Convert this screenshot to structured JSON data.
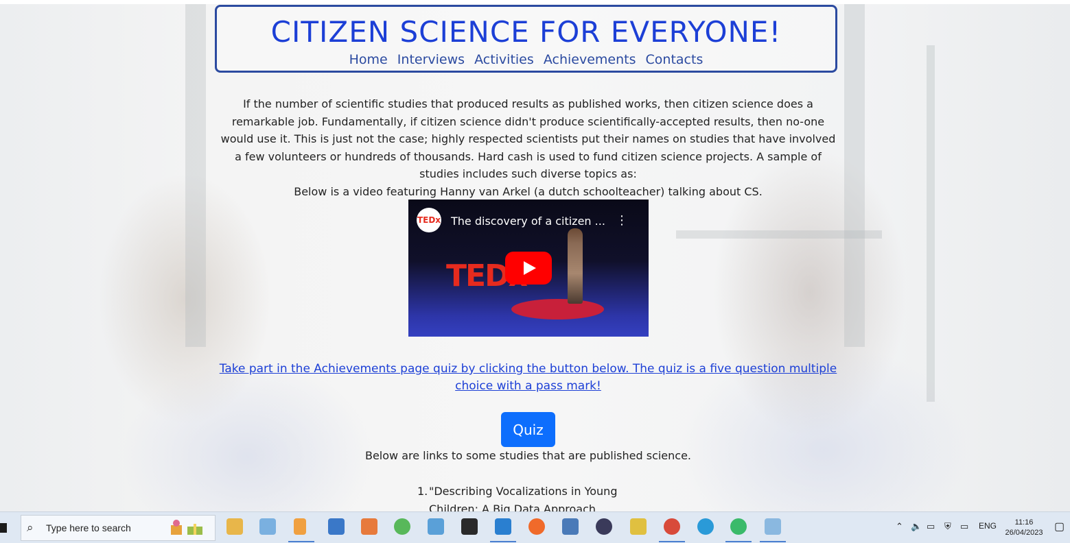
{
  "site": {
    "title": "CITIZEN SCIENCE FOR EVERYONE!",
    "nav": [
      "Home",
      "Interviews",
      "Activities",
      "Achievements",
      "Contacts"
    ]
  },
  "intro": {
    "paragraph": "If the number of scientific studies that produced results as published works, then citizen science does a remarkable job. Fundamentally, if citizen science didn't produce scientifically-accepted results, then no-one would use it. This is just not the case; highly respected scientists put their names on studies that have involved a few volunteers or hundreds of thousands. Hard cash is used to fund citizen science projects. A sample of studies includes such diverse topics as:",
    "video_caption": "Below is a video featuring Hanny van Arkel (a dutch schoolteacher) talking about CS."
  },
  "video": {
    "channel_logo": "TEDx",
    "title": "The discovery of a citizen ...",
    "stage_text": "TEDx",
    "menu_icon": "more-vertical-icon",
    "play_icon": "play-icon"
  },
  "quiz": {
    "link_text": "Take part in the Achievements page quiz by clicking the button below. The quiz is a five question multiple choice with a pass mark!",
    "button_label": "Quiz"
  },
  "studies": {
    "intro": "Below are links to some studies that are published science.",
    "items": [
      {
        "number": "1.",
        "text": "\"Describing Vocalizations in Young Children: A Big Data Approach Through"
      }
    ]
  },
  "taskbar": {
    "search_placeholder": "Type here to search",
    "language": "ENG",
    "time": "11:16",
    "date": "26/04/2023",
    "accent": "#0d6efd"
  }
}
